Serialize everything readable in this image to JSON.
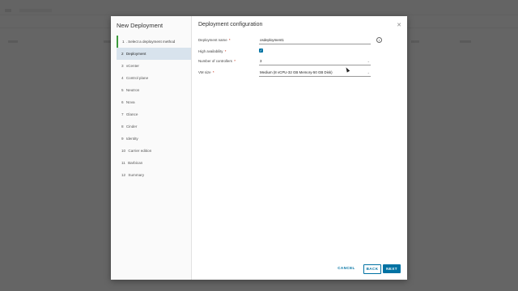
{
  "modal": {
    "title": "New Deployment",
    "close_icon": "close-icon"
  },
  "steps": [
    {
      "num": "1",
      "label": "Select a deployment method",
      "state": "completed"
    },
    {
      "num": "2",
      "label": "Deployment",
      "state": "active"
    },
    {
      "num": "3",
      "label": "vCenter",
      "state": "pending"
    },
    {
      "num": "4",
      "label": "Control plane",
      "state": "pending"
    },
    {
      "num": "5",
      "label": "Neutron",
      "state": "pending"
    },
    {
      "num": "6",
      "label": "Nova",
      "state": "pending"
    },
    {
      "num": "7",
      "label": "Glance",
      "state": "pending"
    },
    {
      "num": "8",
      "label": "Cinder",
      "state": "pending"
    },
    {
      "num": "9",
      "label": "Identity",
      "state": "pending"
    },
    {
      "num": "10",
      "label": "Carrier edition",
      "state": "pending"
    },
    {
      "num": "11",
      "label": "Barbican",
      "state": "pending"
    },
    {
      "num": "12",
      "label": "Summary",
      "state": "pending"
    }
  ],
  "section": {
    "title": "Deployment configuration"
  },
  "form": {
    "deployment_name": {
      "label": "Deployment name",
      "required": "*",
      "value": "osdeployment1",
      "icon": "info-icon"
    },
    "high_availability": {
      "label": "High availability",
      "required": "*",
      "checked": true,
      "icon": "check-icon"
    },
    "num_controllers": {
      "label": "Number of controllers",
      "required": "*",
      "value": "3"
    },
    "vm_size": {
      "label": "VM size",
      "required": "*",
      "value": "Medium (8 vCPU-32 GB Memory-50 GB Disk)"
    }
  },
  "footer": {
    "cancel_label": "CANCEL",
    "back_label": "BACK",
    "next_label": "NEXT"
  },
  "colors": {
    "accent": "#0072a3",
    "active_step_bg": "#d8e3ed",
    "completed_marker": "#3d9b3d"
  }
}
